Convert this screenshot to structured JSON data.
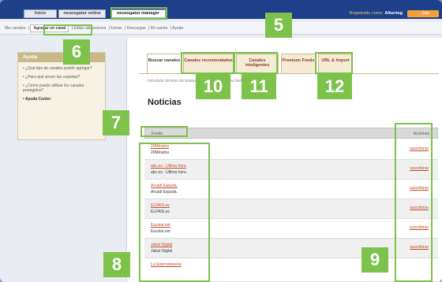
{
  "topbar": {
    "tabs": [
      "Inicio",
      "neuesgator online",
      "neuesgator manager"
    ],
    "registered_label": "Registrado como:",
    "registered_user": "Albertog",
    "exit_label": "→ Salir"
  },
  "subnav": {
    "items": [
      "Mis canales",
      "Agregar un canal",
      "Editar ubicaciones",
      "Extras",
      "Descargas",
      "Mi cuenta",
      "Ayuda"
    ]
  },
  "sidebar": {
    "title": "Ayuda",
    "items": [
      "¿Qué tipo de canales puedo agregar?",
      "¿Para qué sirven las carpetas?",
      "¿Cómo puedo utilizar los canales protegidos?",
      "Ayuda Center"
    ]
  },
  "main": {
    "tabs": [
      {
        "label": "Buscar canales"
      },
      {
        "label": "Canales recomendados"
      },
      {
        "label": "Canales inteligentes"
      },
      {
        "label": "Premium Feeds"
      },
      {
        "label": "URL & Import"
      }
    ],
    "intro": "Introducir término de búsqueda de canal o página web",
    "section_title": "Noticias",
    "table": {
      "feeds_header": "Feeds",
      "actions_header": "Acciones",
      "rows": [
        {
          "link": "20Minutos",
          "name": "20Minutos",
          "action": "suscribirse"
        },
        {
          "link": "abc.es - Última hora",
          "name": "abc.es - Última hora",
          "action": "suscribirse"
        },
        {
          "link": "Arcadi Espada.",
          "name": "Arcadi Espada.",
          "action": "suscribirse"
        },
        {
          "link": "ELPAIS.es",
          "name": "ELPAIS.es",
          "action": "suscribirse"
        },
        {
          "link": "Escolar.net",
          "name": "Escolar.net",
          "action": "suscribirse"
        },
        {
          "link": "Jabal Digital",
          "name": "Jabal Digital",
          "action": "suscribirse"
        },
        {
          "link": "La Estenciteneria",
          "name": "",
          "action": ""
        }
      ]
    }
  },
  "annotations": [
    "5",
    "6",
    "7",
    "8",
    "9",
    "10",
    "11",
    "12"
  ],
  "colors": {
    "topbar": "#1e3f8a",
    "annotation": "#7dc24b",
    "link": "#c44a2b",
    "tab": "#f6ecd6"
  }
}
